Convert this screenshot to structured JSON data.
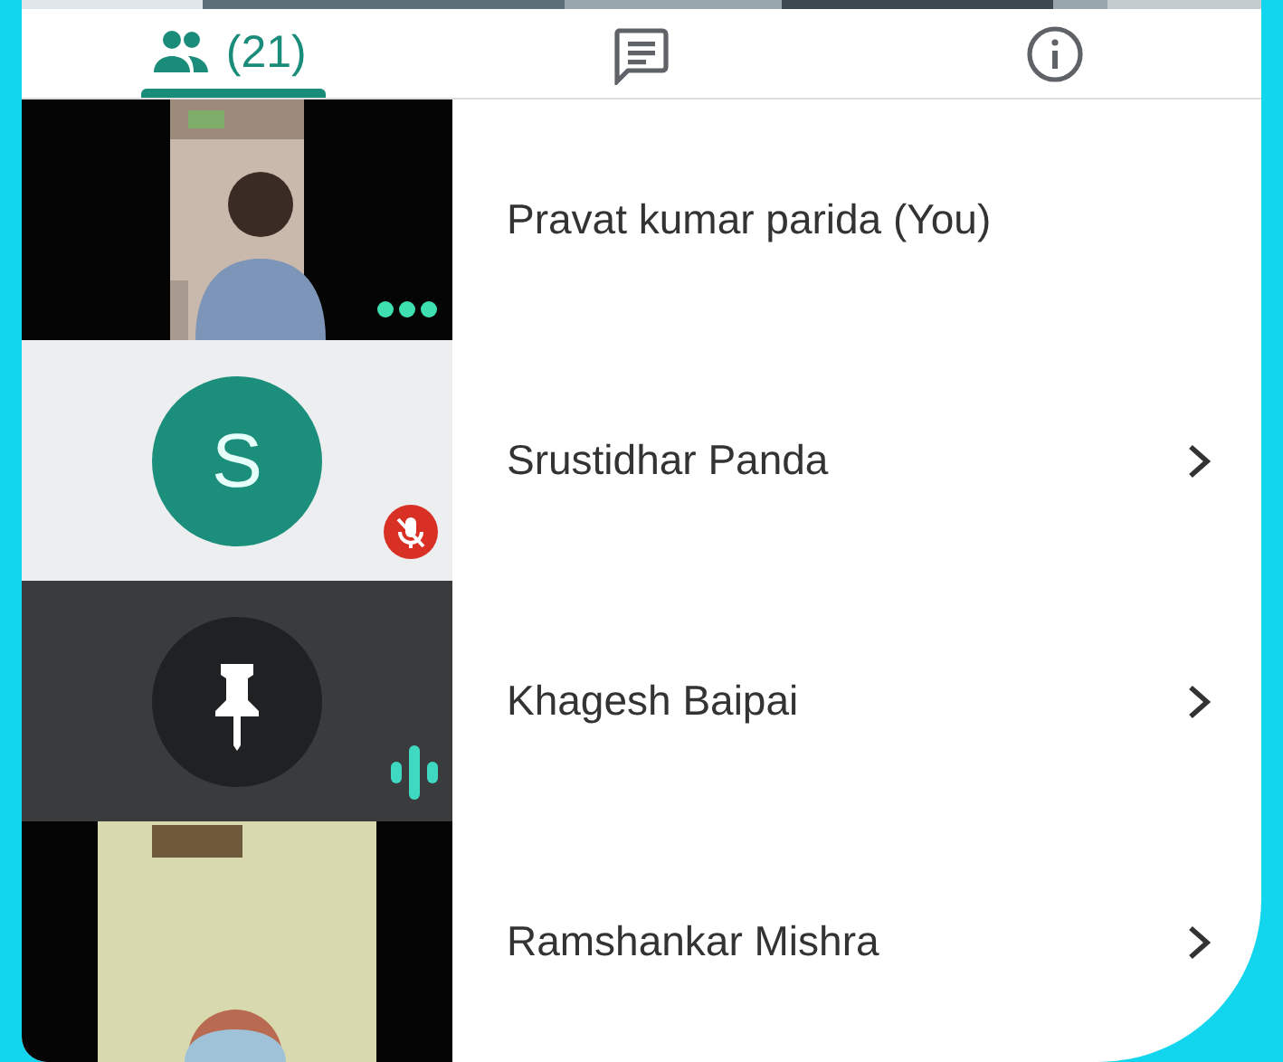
{
  "tabs": [
    {
      "kind": "people",
      "label": "(21)",
      "selected": true
    },
    {
      "kind": "chat",
      "selected": false
    },
    {
      "kind": "info",
      "selected": false
    }
  ],
  "participants": [
    {
      "name": "Pravat kumar parida (You)",
      "kind": "video",
      "badge": {
        "kind": "more"
      },
      "chevron": false
    },
    {
      "name": "Srustidhar Panda",
      "kind": "initial",
      "initial": "S",
      "badge": {
        "kind": "muted"
      },
      "chevron": true
    },
    {
      "name": "Khagesh Baipai",
      "kind": "pin",
      "badge": {
        "kind": "speaking"
      },
      "chevron": true
    },
    {
      "name": "Ramshankar Mishra",
      "kind": "video",
      "chevron": true
    }
  ]
}
